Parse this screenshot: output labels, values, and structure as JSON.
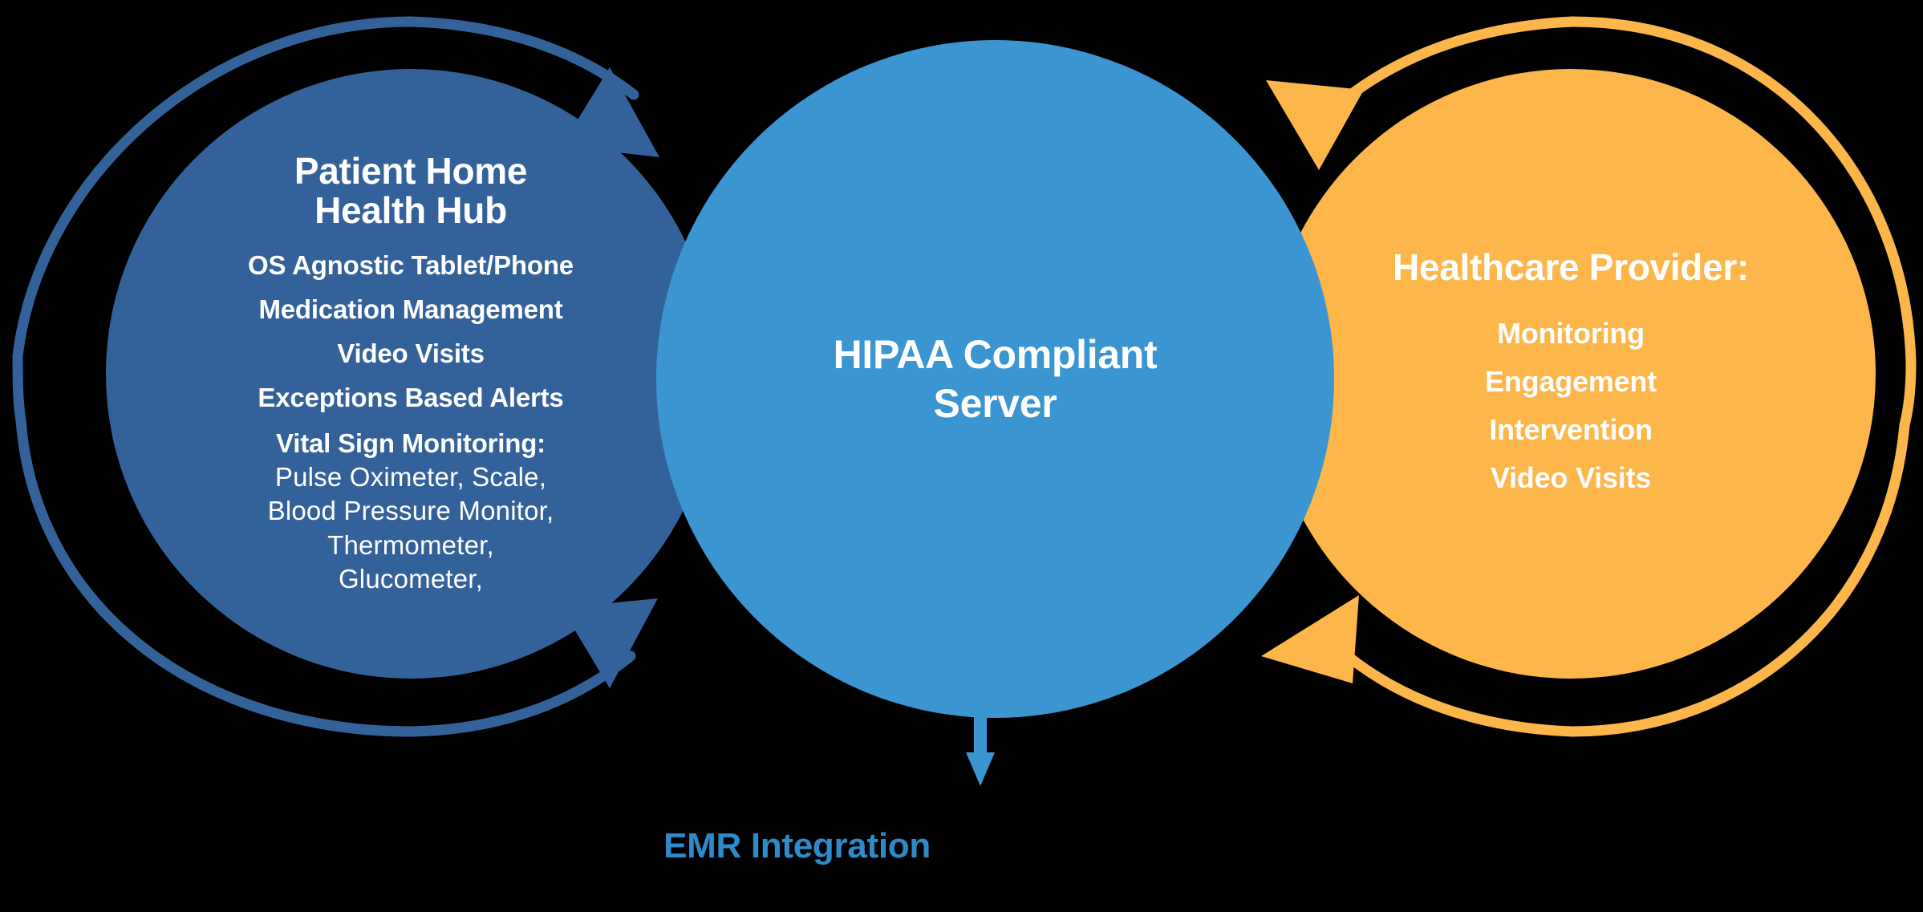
{
  "diagram": {
    "background_color": "#000000",
    "left_circle": {
      "name": "Patient Home Health Hub",
      "fill_color": "#33629A",
      "title_lines": [
        "Patient Home",
        "Health Hub"
      ],
      "items": [
        "OS Agnostic Tablet/Phone",
        "Medication Management",
        "Video Visits",
        "Exceptions Based Alerts"
      ],
      "sub_heading": "Vital Sign Monitoring:",
      "sub_items": [
        "Pulse  Oximeter, Scale,",
        "Blood Pressure Monitor,",
        "Thermometer,",
        "Glucometer,"
      ]
    },
    "center_circle": {
      "name": "HIPAA Compliant Server",
      "fill_color": "#3A95D1",
      "title_lines": [
        "HIPAA Compliant",
        "Server"
      ]
    },
    "right_circle": {
      "name": "Healthcare Provider",
      "fill_color": "#FCB64A",
      "title": "Healthcare Provider:",
      "items": [
        "Monitoring",
        "Engagement",
        "Intervention",
        "Video Visits"
      ]
    },
    "bottom": {
      "label": "EMR Integration",
      "label_color": "#2E8BCB",
      "arrow_color": "#3A95D1",
      "arrow_direction": "down"
    },
    "arrows": [
      {
        "id": "left-top-arc",
        "color": "#33629A",
        "direction": "clockwise-inward-right"
      },
      {
        "id": "left-bottom-arc",
        "color": "#33629A",
        "direction": "counterclockwise-inward-right"
      },
      {
        "id": "right-top-arc",
        "color": "#FCB64A",
        "direction": "counterclockwise-inward-left"
      },
      {
        "id": "right-bottom-arc",
        "color": "#FCB64A",
        "direction": "clockwise-inward-left"
      }
    ]
  }
}
